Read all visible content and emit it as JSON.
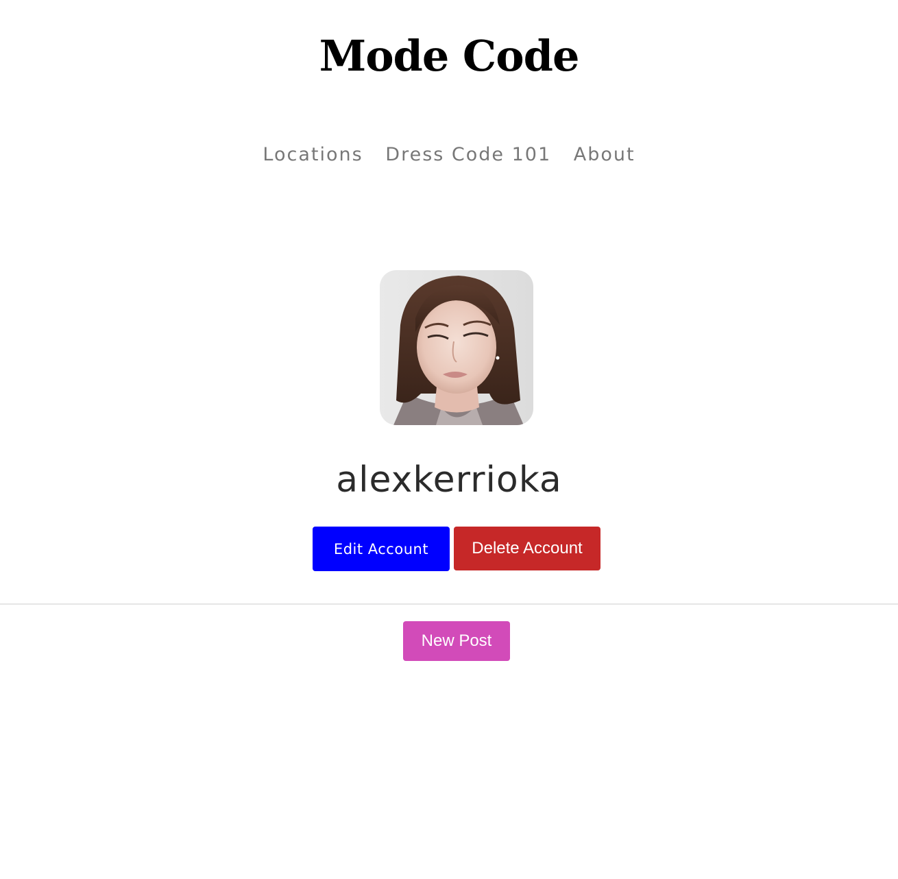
{
  "header": {
    "title": "Mode Code"
  },
  "nav": {
    "items": [
      {
        "label": "Locations"
      },
      {
        "label": "Dress Code 101"
      },
      {
        "label": "About"
      }
    ]
  },
  "profile": {
    "avatar_icon": "profile-photo",
    "username": "alexkerrioka"
  },
  "actions": {
    "edit_label": "Edit Account",
    "delete_label": "Delete Account",
    "new_post_label": "New Post"
  },
  "colors": {
    "edit_button": "#0000ff",
    "delete_button": "#c62828",
    "new_post_button": "#d24bb9",
    "nav_text": "#777777",
    "username_text": "#2b2b2b"
  }
}
